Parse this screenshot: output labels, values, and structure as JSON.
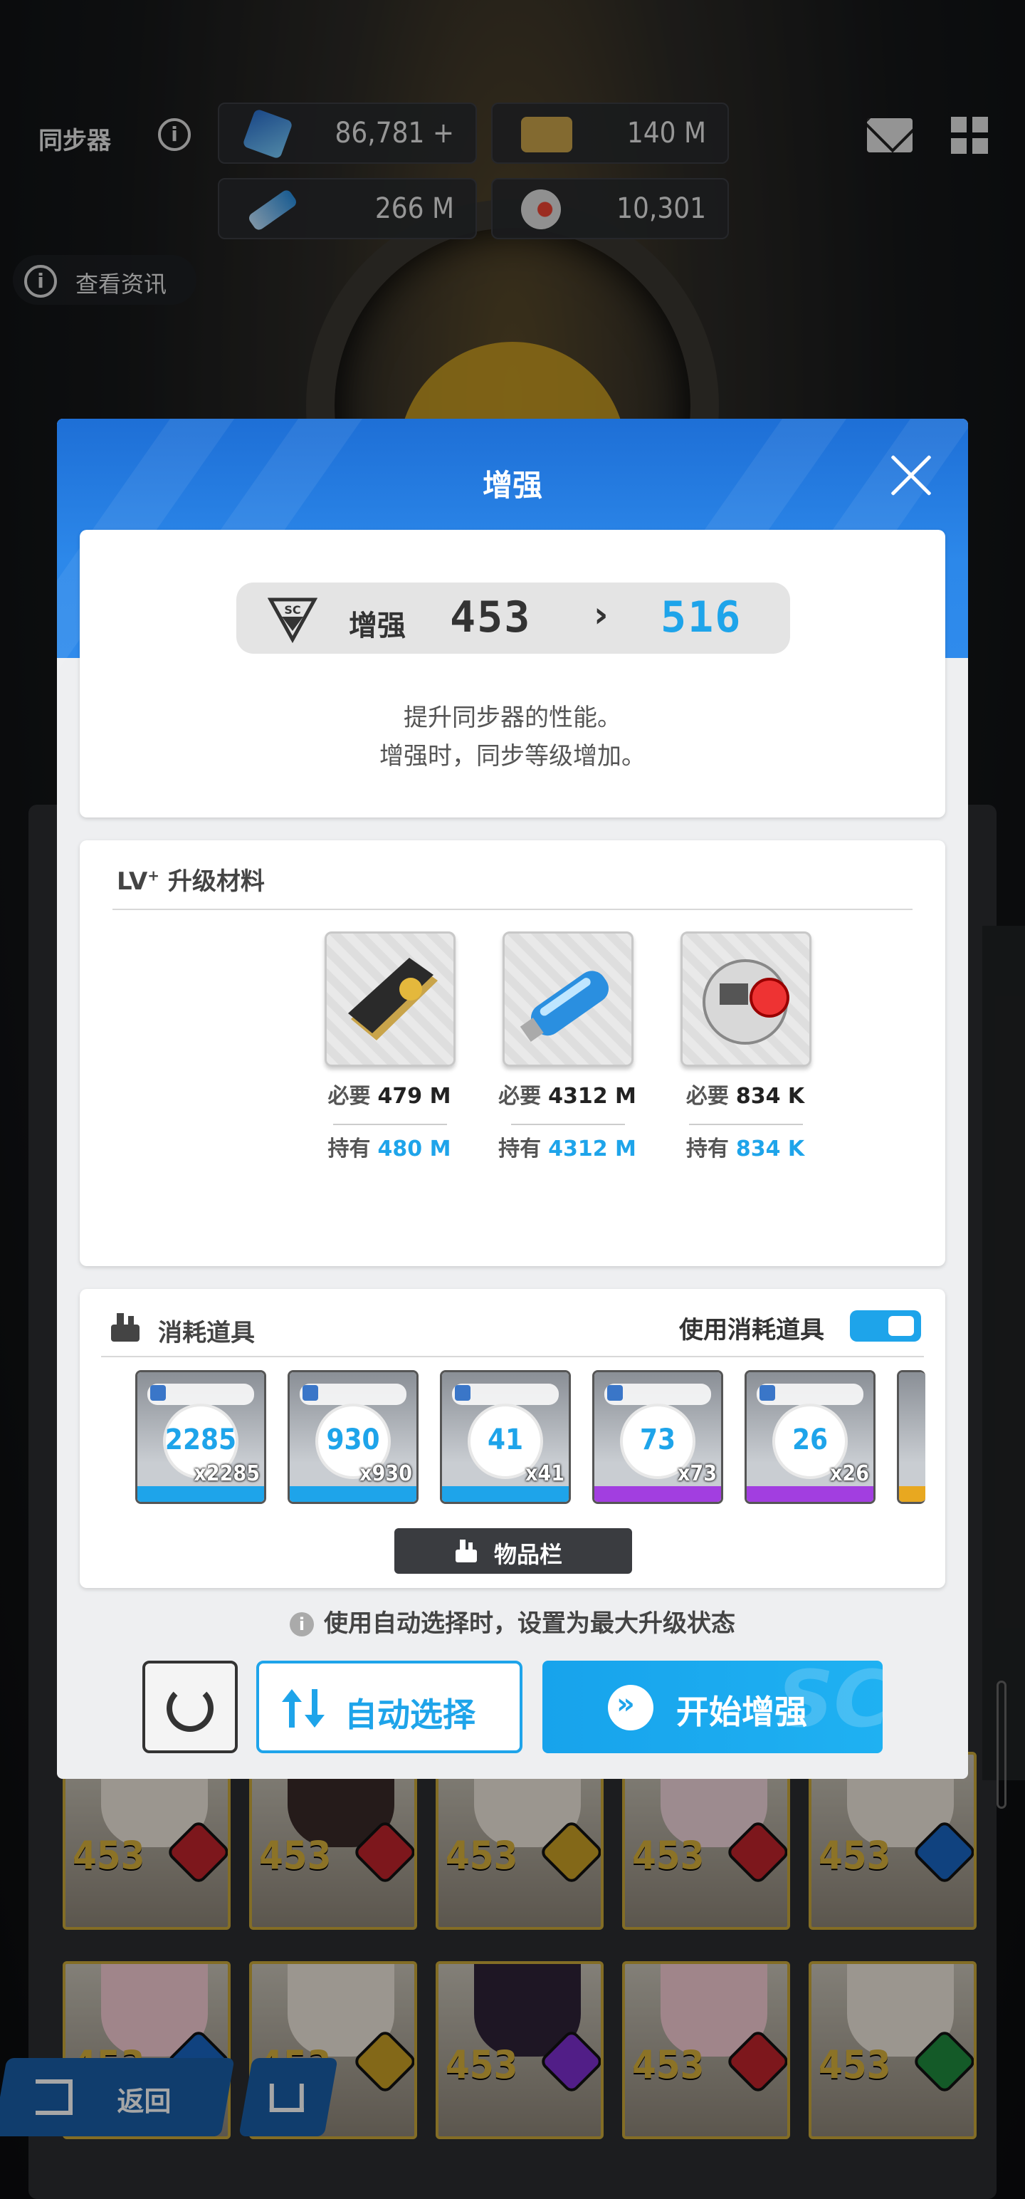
{
  "header": {
    "title": "同步器",
    "resources": [
      {
        "icon": "crystal-icon",
        "value": "86,781",
        "plus": "+"
      },
      {
        "icon": "credit-card-icon",
        "value": "140 M"
      },
      {
        "icon": "data-drive-icon",
        "value": "266 M"
      },
      {
        "icon": "core-dust-icon",
        "value": "10,301"
      }
    ],
    "view_info": "查看资讯"
  },
  "background": {
    "character_levels": [
      "453",
      "453",
      "453",
      "453",
      "453",
      "453",
      "453",
      "453",
      "453",
      "453"
    ],
    "back_label": "返回"
  },
  "modal": {
    "title": "增强",
    "level": {
      "label": "增强",
      "from": "453",
      "arrow": "›",
      "to": "516",
      "badge": "SC"
    },
    "description": [
      "提升同步器的性能。",
      "增强时，同步等级增加。"
    ],
    "materials_header": {
      "prefix": "LV",
      "sup": "+",
      "label": "升级材料"
    },
    "materials": [
      {
        "icon": "gold-card-icon",
        "required_label": "必要",
        "required": "479 M",
        "owned_label": "持有",
        "owned": "480 M"
      },
      {
        "icon": "usb-drive-icon",
        "required_label": "必要",
        "required": "4312 M",
        "owned_label": "持有",
        "owned": "4312 M"
      },
      {
        "icon": "core-orb-icon",
        "required_label": "必要",
        "required": "834 K",
        "owned_label": "持有",
        "owned": "834 K"
      }
    ],
    "consumables_header": "消耗道具",
    "use_consumables_label": "使用消耗道具",
    "use_consumables_on": true,
    "consumables": [
      {
        "value": "2285",
        "count": "x2285",
        "rarity_color": "#1ea4ea"
      },
      {
        "value": "930",
        "count": "x930",
        "rarity_color": "#1ea4ea"
      },
      {
        "value": "41",
        "count": "x41",
        "rarity_color": "#1ea4ea"
      },
      {
        "value": "73",
        "count": "x73",
        "rarity_color": "#a23ee0"
      },
      {
        "value": "26",
        "count": "x26",
        "rarity_color": "#a23ee0"
      }
    ],
    "inventory_label": "物品栏",
    "hint": "使用自动选择时，设置为最大升级状态",
    "auto_select_label": "自动选择",
    "start_label": "开始增强"
  },
  "colors": {
    "accent": "#1ea4ea",
    "header_blue": "#2c88ea",
    "rare_purple": "#a23ee0",
    "gold": "#d8b13c"
  }
}
